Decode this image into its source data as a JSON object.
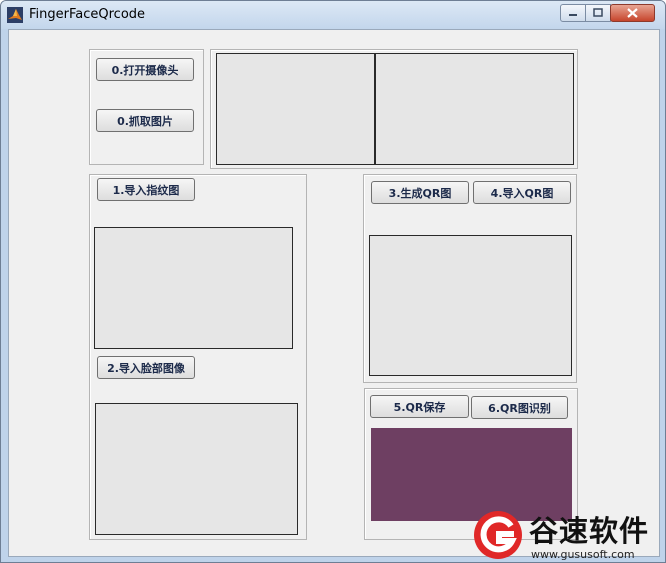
{
  "window": {
    "title": "FingerFaceQrcode",
    "icon": "matlab-icon",
    "controls": [
      "minimize-icon",
      "maximize-icon",
      "close-icon"
    ]
  },
  "buttons": {
    "open_camera": "0.打开摄像头",
    "capture_image": "0.抓取图片",
    "import_fingerprint": "1.导入指纹图",
    "import_face": "2.导入脸部图像",
    "generate_qr": "3.生成QR图",
    "import_qr": "4.导入QR图",
    "save_qr": "5.QR保存",
    "recognize_qr": "6.QR图识别"
  },
  "colors": {
    "qr_display_fill": "#6e3f62",
    "axes_fill": "#e6e6e6",
    "client_bg": "#f0f0f0"
  },
  "watermark": {
    "title": "谷速软件",
    "url": "www.gususoft.com",
    "logo": "gususoft-logo"
  }
}
